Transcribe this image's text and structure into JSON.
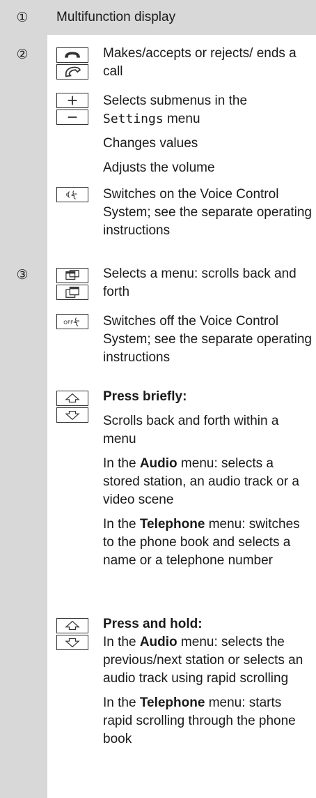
{
  "rows": [
    {
      "number": "①",
      "text": "Multifunction display"
    },
    {
      "number": "②"
    },
    {
      "number": "③"
    }
  ],
  "call": {
    "text": "Makes/accepts or rejects/ ends a call",
    "icons": [
      "phone-hangup-icon",
      "phone-accept-icon"
    ]
  },
  "plusminus": {
    "line1": "Selects submenus in the",
    "settings_word": "Settings",
    "menu_word": " menu",
    "line2": "Changes values",
    "line3": "Adjusts the volume",
    "icons": [
      "plus-icon",
      "minus-icon"
    ]
  },
  "voice_on": {
    "text": "Switches on the Voice Control System; see the separate operating instructions",
    "icon": "voice-on-icon"
  },
  "menu_scroll": {
    "text": "Selects a menu: scrolls back and forth",
    "icons": [
      "page-back-icon",
      "page-forward-icon"
    ]
  },
  "voice_off": {
    "text": "Switches off the Voice Control System; see the separate operating instructions",
    "icon": "voice-off-icon",
    "icon_label": "OFF"
  },
  "press_briefly": {
    "heading": "Press briefly:",
    "p1": "Scrolls back and forth within a menu",
    "p2_pre": "In the ",
    "p2_bold": "Audio",
    "p2_post": " menu: selects a stored station, an audio track or a video scene",
    "p3_pre": "In the ",
    "p3_bold": "Telephone",
    "p3_post": " menu: switches to the phone book and selects a name or a telephone number",
    "icons": [
      "arrow-up-icon",
      "arrow-down-icon"
    ]
  },
  "press_hold": {
    "heading": "Press and hold:",
    "p1_pre": "In the ",
    "p1_bold": "Audio",
    "p1_post": " menu: selects the previous/next station or selects an audio track using rapid scrolling",
    "p2_pre": "In the ",
    "p2_bold": "Telephone",
    "p2_post": " menu: starts rapid scrolling through the phone book",
    "icons": [
      "arrow-up-icon",
      "arrow-down-icon"
    ]
  }
}
